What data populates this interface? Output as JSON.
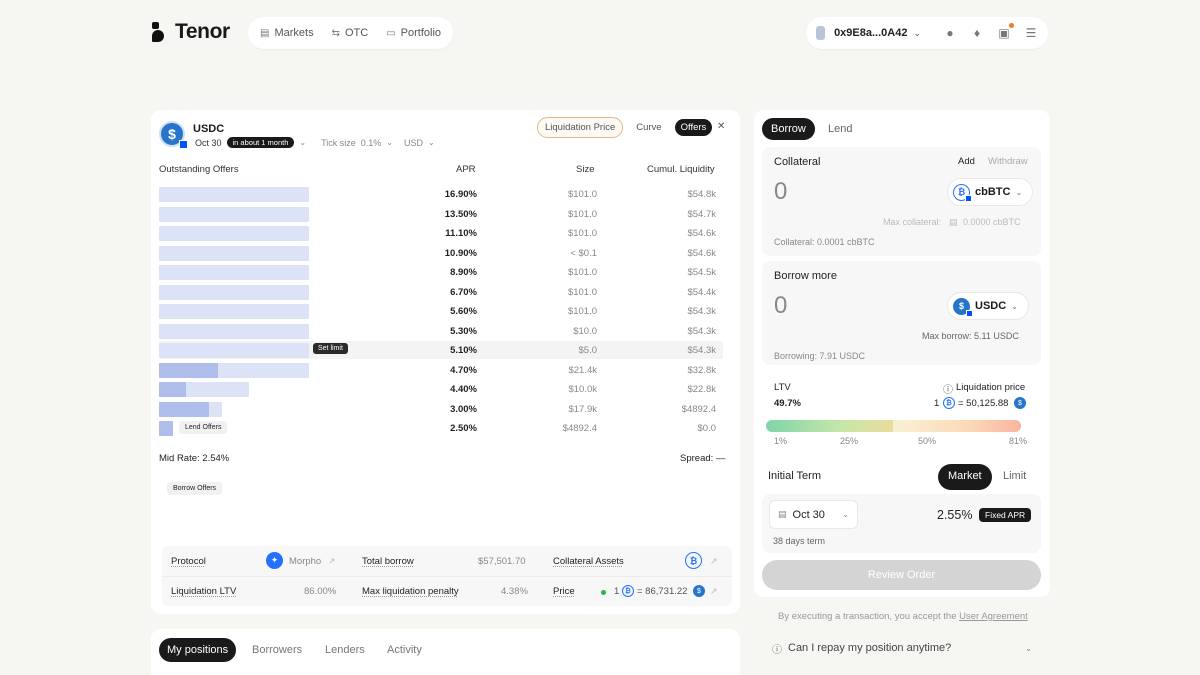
{
  "brand": {
    "name": "Tenor"
  },
  "nav": [
    {
      "label": "Markets",
      "icon": "markets-icon"
    },
    {
      "label": "OTC",
      "icon": "swap-icon"
    },
    {
      "label": "Portfolio",
      "icon": "portfolio-icon"
    }
  ],
  "wallet": {
    "address": "0x9E8a...0A42"
  },
  "market": {
    "asset": "USDC",
    "date": "Oct 30",
    "eta": "in about 1 month",
    "tick_label": "Tick size",
    "tick_value": "0.1%",
    "currency": "USD"
  },
  "view_tabs": [
    "Liquidation Price",
    "Curve",
    "Offers"
  ],
  "orderbook": {
    "headers": {
      "title": "Outstanding Offers",
      "apr": "APR",
      "size": "Size",
      "liq": "Cumul. Liquidity"
    },
    "rows": [
      {
        "apr": "16.90%",
        "size": "$101.0",
        "liq": "$54.8k",
        "depth": 1.0,
        "fill": 0
      },
      {
        "apr": "13.50%",
        "size": "$101.0",
        "liq": "$54.7k",
        "depth": 1.0,
        "fill": 0
      },
      {
        "apr": "11.10%",
        "size": "$101.0",
        "liq": "$54.6k",
        "depth": 1.0,
        "fill": 0
      },
      {
        "apr": "10.90%",
        "size": "< $0.1",
        "liq": "$54.6k",
        "depth": 1.0,
        "fill": 0
      },
      {
        "apr": "8.90%",
        "size": "$101.0",
        "liq": "$54.5k",
        "depth": 1.0,
        "fill": 0
      },
      {
        "apr": "6.70%",
        "size": "$101.0",
        "liq": "$54.4k",
        "depth": 1.0,
        "fill": 0
      },
      {
        "apr": "5.60%",
        "size": "$101.0",
        "liq": "$54.3k",
        "depth": 1.0,
        "fill": 0
      },
      {
        "apr": "5.30%",
        "size": "$10.0",
        "liq": "$54.3k",
        "depth": 1.0,
        "fill": 0
      },
      {
        "apr": "5.10%",
        "size": "$5.0",
        "liq": "$54.3k",
        "depth": 1.0,
        "fill": 0
      },
      {
        "apr": "4.70%",
        "size": "$21.4k",
        "liq": "$32.8k",
        "depth": 1.0,
        "fill": 0.39
      },
      {
        "apr": "4.40%",
        "size": "$10.0k",
        "liq": "$22.8k",
        "depth": 0.6,
        "fill": 0.18
      },
      {
        "apr": "3.00%",
        "size": "$17.9k",
        "liq": "$4892.4",
        "depth": 0.42,
        "fill": 0.33
      },
      {
        "apr": "2.50%",
        "size": "$4892.4",
        "liq": "$0.0",
        "depth": 0.09,
        "fill": 0.09
      }
    ],
    "set_limit": "Set limit",
    "lend_offers": "Lend Offers",
    "borrow_offers": "Borrow Offers",
    "mid_rate": "Mid Rate: 2.54%",
    "spread": "Spread: —"
  },
  "stats": {
    "protocol_label": "Protocol",
    "protocol_value": "Morpho",
    "total_borrow_label": "Total borrow",
    "total_borrow_value": "$57,501.70",
    "collateral_assets_label": "Collateral Assets",
    "liq_ltv_label": "Liquidation LTV",
    "liq_ltv_value": "86.00%",
    "max_penalty_label": "Max liquidation penalty",
    "max_penalty_value": "4.38%",
    "price_label": "Price",
    "price_qty": "1",
    "price_value": "= 86,731.22"
  },
  "positions_tabs": [
    "My positions",
    "Borrowers",
    "Lenders",
    "Activity"
  ],
  "trade": {
    "tabs": [
      "Borrow",
      "Lend"
    ],
    "collateral": {
      "title": "Collateral",
      "add": "Add",
      "withdraw": "Withdraw",
      "amount": "0",
      "token": "cbBTC",
      "max_label": "Max collateral:",
      "max_value": "0.0000 cbBTC",
      "current": "Collateral: 0.0001 cbBTC"
    },
    "borrow": {
      "title": "Borrow more",
      "amount": "0",
      "token": "USDC",
      "max": "Max borrow: 5.11 USDC",
      "current": "Borrowing: 7.91 USDC"
    },
    "ltv": {
      "label": "LTV",
      "value": "49.7%",
      "level": 0.497,
      "liq_label": "Liquidation price",
      "liq_qty": "1",
      "liq_value": "= 50,125.88",
      "ticks": [
        "1%",
        "25%",
        "50%",
        "81%"
      ]
    },
    "term": {
      "label": "Initial Term",
      "modes": [
        "Market",
        "Limit"
      ],
      "date": "Oct 30",
      "rate": "2.55%",
      "rate_tag": "Fixed APR",
      "duration": "38 days term"
    },
    "review": "Review Order",
    "agreement_prefix": "By executing a transaction, you accept the",
    "agreement_link": "User Agreement",
    "faq": "Can I repay my position anytime?"
  },
  "colors": {
    "bar_depth": "#dce3f7",
    "bar_fill": "#aebde9",
    "accent": "#2470ff",
    "usdc": "#2775ca"
  }
}
